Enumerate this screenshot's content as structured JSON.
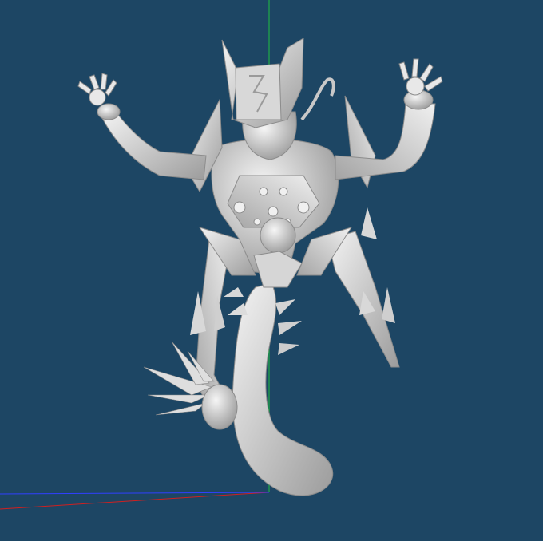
{
  "viewport": {
    "background_color": "#1d4664",
    "model_color": "#e0e0e0",
    "model_shade_color": "#a8a8a8",
    "axis_colors": {
      "x": "#d02020",
      "y": "#20c040",
      "z": "#3040ff"
    },
    "model": "humanoid-serpent-figure",
    "shading": "smooth-gray"
  }
}
